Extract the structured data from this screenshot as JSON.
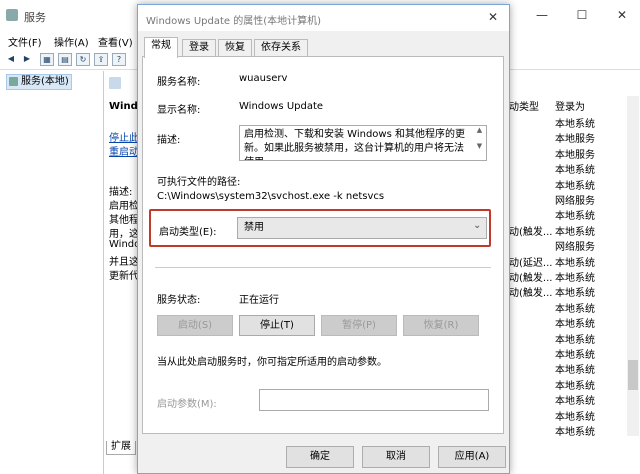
{
  "bg": {
    "title": "服务",
    "controls": {
      "minimize": "—",
      "maximize": "☐",
      "close": "✕"
    },
    "menu": [
      "文件(F)",
      "操作(A)",
      "查看(V)"
    ],
    "tree_item": "服务(本地)",
    "mid_heading": "Windo",
    "mid_links": [
      "停止此",
      "重启动"
    ],
    "mid_desc": [
      "描述:",
      "启用检",
      "其他程",
      "用，这",
      "Windo",
      "并且这",
      "更新代"
    ],
    "list_headers": {
      "startup": "动类型",
      "logon": "登录为"
    },
    "list_rows": [
      {
        "startup": "",
        "logon": "本地系统"
      },
      {
        "startup": "",
        "logon": "本地服务"
      },
      {
        "startup": "",
        "logon": "本地服务"
      },
      {
        "startup": "",
        "logon": "本地系统"
      },
      {
        "startup": "",
        "logon": "本地系统"
      },
      {
        "startup": "",
        "logon": "网络服务"
      },
      {
        "startup": "",
        "logon": "本地系统"
      },
      {
        "startup": "动(触发...",
        "logon": "本地系统"
      },
      {
        "startup": "",
        "logon": "网络服务"
      },
      {
        "startup": "动(延迟...",
        "logon": "本地系统"
      },
      {
        "startup": "动(触发...",
        "logon": "本地系统"
      },
      {
        "startup": "动(触发...",
        "logon": "本地系统"
      },
      {
        "startup": "",
        "logon": "本地系统"
      },
      {
        "startup": "",
        "logon": "本地系统"
      },
      {
        "startup": "",
        "logon": "本地系统"
      },
      {
        "startup": "",
        "logon": "本地系统"
      },
      {
        "startup": "",
        "logon": "本地系统"
      },
      {
        "startup": "",
        "logon": "本地系统"
      },
      {
        "startup": "",
        "logon": "本地系统"
      },
      {
        "startup": "",
        "logon": "本地系统"
      },
      {
        "startup": "",
        "logon": "本地系统"
      }
    ],
    "bottom_tab": "扩展"
  },
  "dialog": {
    "title": "Windows Update 的属性(本地计算机)",
    "close": "✕",
    "tabs": [
      "常规",
      "登录",
      "恢复",
      "依存关系"
    ],
    "service_name_label": "服务名称:",
    "service_name": "wuauserv",
    "display_name_label": "显示名称:",
    "display_name": "Windows Update",
    "description_label": "描述:",
    "description": "启用检测、下载和安装 Windows 和其他程序的更新。如果此服务被禁用，这台计算机的用户将无法使用",
    "exe_path_label": "可执行文件的路径:",
    "exe_path": "C:\\Windows\\system32\\svchost.exe -k netsvcs",
    "startup_type_label": "启动类型(E):",
    "startup_type": "禁用",
    "status_label": "服务状态:",
    "status_value": "正在运行",
    "buttons": {
      "start": "启动(S)",
      "stop": "停止(T)",
      "pause": "暂停(P)",
      "resume": "恢复(R)"
    },
    "hint": "当从此处启动服务时，你可指定所适用的启动参数。",
    "params_label": "启动参数(M):",
    "params_value": "",
    "ok": "确定",
    "cancel": "取消",
    "apply": "应用(A)"
  },
  "colors": {
    "highlight_border": "#c0392b",
    "link": "#0645ad",
    "dialog_border": "#7aa5d8"
  }
}
